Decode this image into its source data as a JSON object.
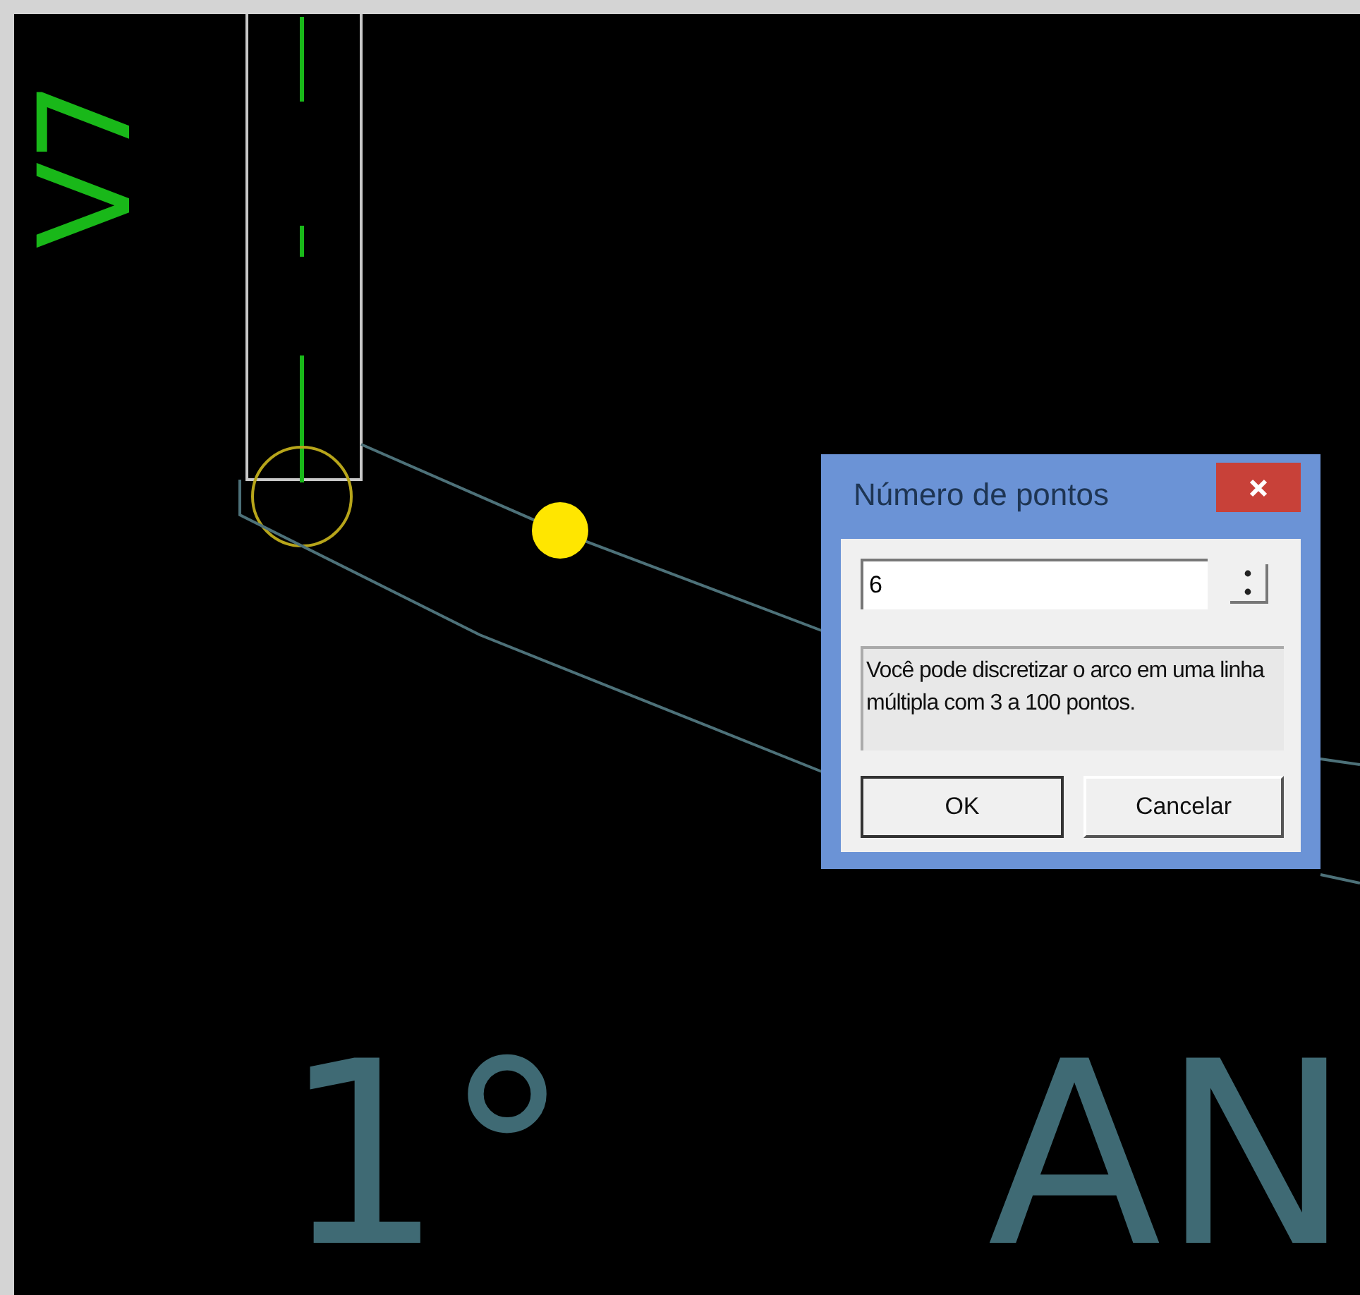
{
  "drawing_texts": [
    {
      "text": "V7",
      "kind": "vertical"
    },
    {
      "text": "1°",
      "kind": "label"
    },
    {
      "text": "AN",
      "kind": "label"
    }
  ],
  "dialog": {
    "title": "Número de pontos",
    "value": "6",
    "description": "Você pode discretizar o arco em uma linha múltipla com 3 a 100 pontos.",
    "buttons": [
      "OK",
      "Cancelar"
    ]
  }
}
